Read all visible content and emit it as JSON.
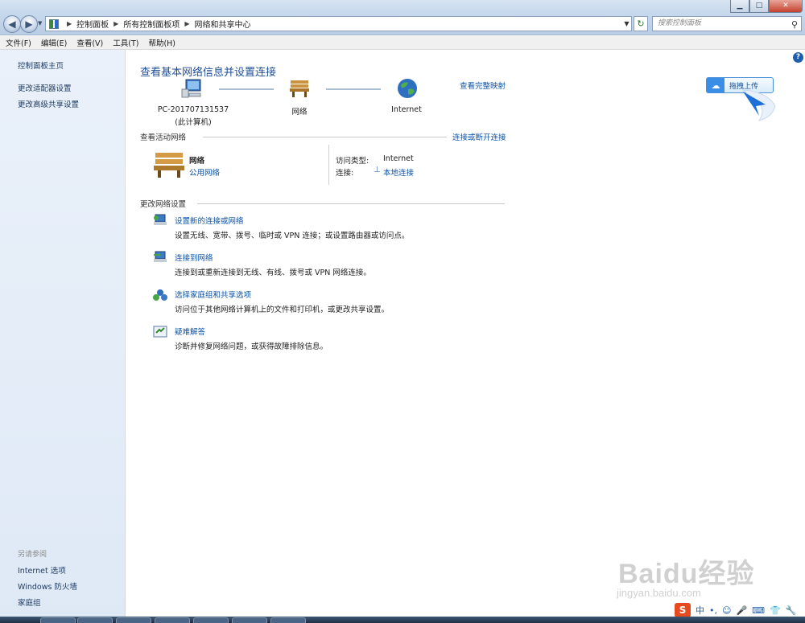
{
  "address_bar": {
    "crumbs": [
      "控制面板",
      "所有控制面板项",
      "网络和共享中心"
    ],
    "search_placeholder": "搜索控制面板"
  },
  "menu": [
    "文件(F)",
    "编辑(E)",
    "查看(V)",
    "工具(T)",
    "帮助(H)"
  ],
  "sidebar": {
    "home": "控制面板主页",
    "links": [
      "更改适配器设置",
      "更改高级共享设置"
    ],
    "see_also_title": "另请参阅",
    "see_also": [
      "Internet 选项",
      "Windows 防火墙",
      "家庭组"
    ]
  },
  "main": {
    "title": "查看基本网络信息并设置连接",
    "view_full_map": "查看完整映射",
    "map": {
      "computer_name": "PC-201707131537",
      "computer_sub": "(此计算机)",
      "network": "网络",
      "internet": "Internet"
    },
    "active": {
      "title": "查看活动网络",
      "connect_disconnect": "连接或断开连接",
      "network_name": "网络",
      "network_type": "公用网络",
      "access_type_label": "访问类型:",
      "access_type_value": "Internet",
      "connection_label": "连接:",
      "connection_value": "本地连接"
    },
    "change": {
      "title": "更改网络设置",
      "tasks": [
        {
          "title": "设置新的连接或网络",
          "desc": "设置无线、宽带、拨号、临时或 VPN 连接；或设置路由器或访问点。"
        },
        {
          "title": "连接到网络",
          "desc": "连接到或重新连接到无线、有线、拨号或 VPN 网络连接。"
        },
        {
          "title": "选择家庭组和共享选项",
          "desc": "访问位于其他网络计算机上的文件和打印机，或更改共享设置。"
        },
        {
          "title": "疑难解答",
          "desc": "诊断并修复网络问题，或获得故障排除信息。"
        }
      ]
    }
  },
  "upload_widget": {
    "label": "拖拽上传"
  },
  "watermark": {
    "brand": "Baidu经验",
    "url": "jingyan.baidu.com"
  },
  "ime": {
    "logo": "S",
    "mode": "中"
  }
}
